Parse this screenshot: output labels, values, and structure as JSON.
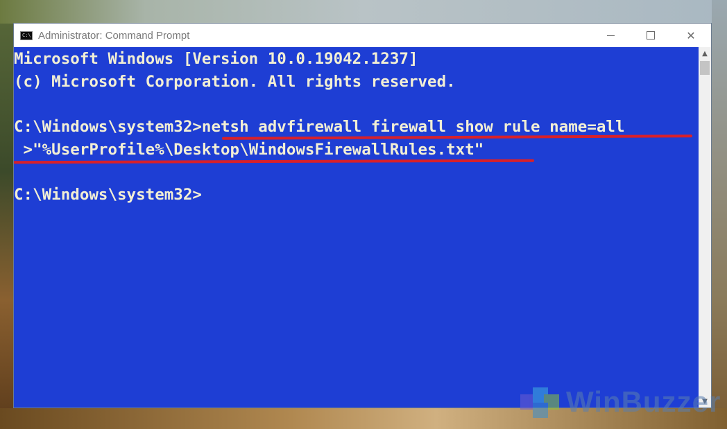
{
  "window": {
    "title": "Administrator: Command Prompt",
    "controls": {
      "minimize": "minimize",
      "maximize": "maximize",
      "close": "✕"
    }
  },
  "console": {
    "lines": [
      "Microsoft Windows [Version 10.0.19042.1237]",
      "(c) Microsoft Corporation. All rights reserved.",
      "",
      "C:\\Windows\\system32>netsh advfirewall firewall show rule name=all",
      " >\"%UserProfile%\\Desktop\\WindowsFirewallRules.txt\"",
      "",
      "C:\\Windows\\system32>"
    ],
    "highlight_color": "#d8202a",
    "background_color": "#1e3ed4",
    "text_color": "#f2efd5"
  },
  "watermark": {
    "text": "WinBuzzer"
  },
  "icons": {
    "app": "cmd-icon",
    "scroll_up": "chevron-up-icon",
    "scroll_down": "chevron-down-icon"
  }
}
